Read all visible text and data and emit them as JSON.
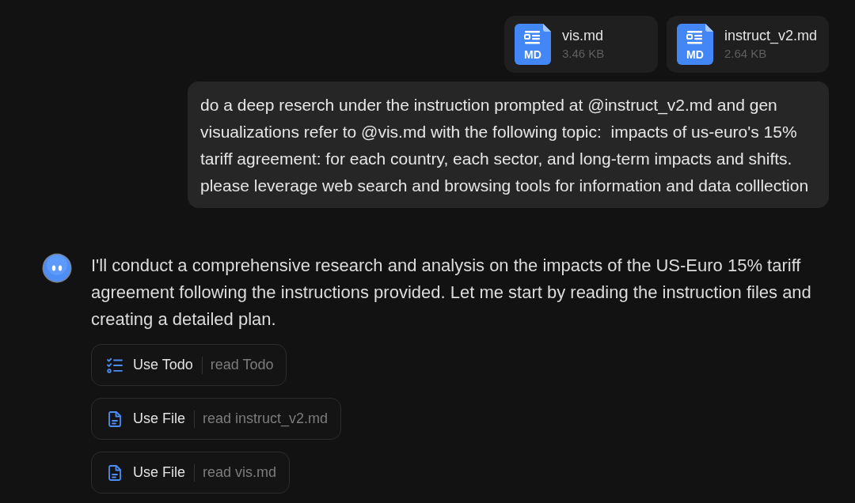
{
  "attachments": [
    {
      "name": "vis.md",
      "size": "3.46 KB",
      "badge": "MD"
    },
    {
      "name": "instruct_v2.md",
      "size": "2.64 KB",
      "badge": "MD"
    }
  ],
  "user_message": {
    "text": "do a deep reserch under the instruction prompted at @instruct_v2.md and gen visualizations refer to @vis.md with the following topic:  impacts of us-euro's 15% tariff agreement: for each country, each sector, and long-term impacts and shifts. please leverage web search and browsing tools for information and data colllection"
  },
  "assistant_message": {
    "text": "I'll conduct a comprehensive research and analysis on the impacts of the US-Euro 15% tariff agreement following the instructions provided. Let me start by reading the instruction files and creating a detailed plan.",
    "tool_calls": [
      {
        "kind": "todo",
        "tool": "Use Todo",
        "action": "read Todo"
      },
      {
        "kind": "file",
        "tool": "Use File",
        "action": "read instruct_v2.md"
      },
      {
        "kind": "file",
        "tool": "Use File",
        "action": "read vis.md"
      }
    ]
  }
}
